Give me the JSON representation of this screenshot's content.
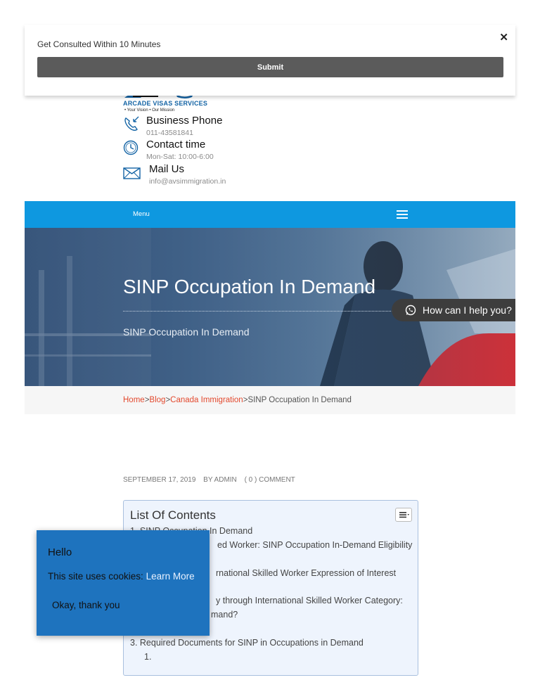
{
  "consult": {
    "label": "Get Consulted Within 10 Minutes",
    "submit_label": "Submit",
    "close_label": "✕"
  },
  "logo": {
    "title": "ARCADE VISAS SERVICES",
    "tagline": "• Your Vision • Our Mission"
  },
  "contacts": {
    "phone": {
      "title": "Business Phone",
      "value": "011-43581841"
    },
    "time": {
      "title": "Contact time",
      "value": "Mon-Sat: 10:00-6:00"
    },
    "mail": {
      "title": "Mail Us",
      "value": "info@avsimmigration.in"
    }
  },
  "nav": {
    "menu_label": "Menu"
  },
  "hero": {
    "title": "SINP Occupation In Demand",
    "subtitle": "SINP Occupation In Demand"
  },
  "whatsapp": {
    "label": "How can I help you?"
  },
  "breadcrumb": {
    "home": "Home",
    "blog": "Blog",
    "category": "Canada Immigration",
    "current": "SINP Occupation In Demand",
    "separator": ">"
  },
  "meta": {
    "date": "SEPTEMBER 17, 2019",
    "author": "BY ADMIN",
    "comments": "( 0 ) COMMENT"
  },
  "toc": {
    "title": "List Of Contents",
    "items": [
      "1. SINP Occupation In Demand",
      "ed Worker: SINP Occupation In-Demand Eligibility",
      "rnational Skilled Worker Expression of Interest",
      "y through International Skilled Worker Category:",
      "mand?",
      "3. Required Documents for SINP in Occupations in Demand",
      "1."
    ]
  },
  "cookie": {
    "hello": "Hello",
    "text": "This site uses cookies:",
    "link": "Learn More",
    "button": "Okay, thank you"
  },
  "colors": {
    "nav_blue": "#0e98e0",
    "breadcrumb_link": "#e3492e",
    "cookie_blue": "#1e73be",
    "submit_gray": "#5b5b5b"
  }
}
